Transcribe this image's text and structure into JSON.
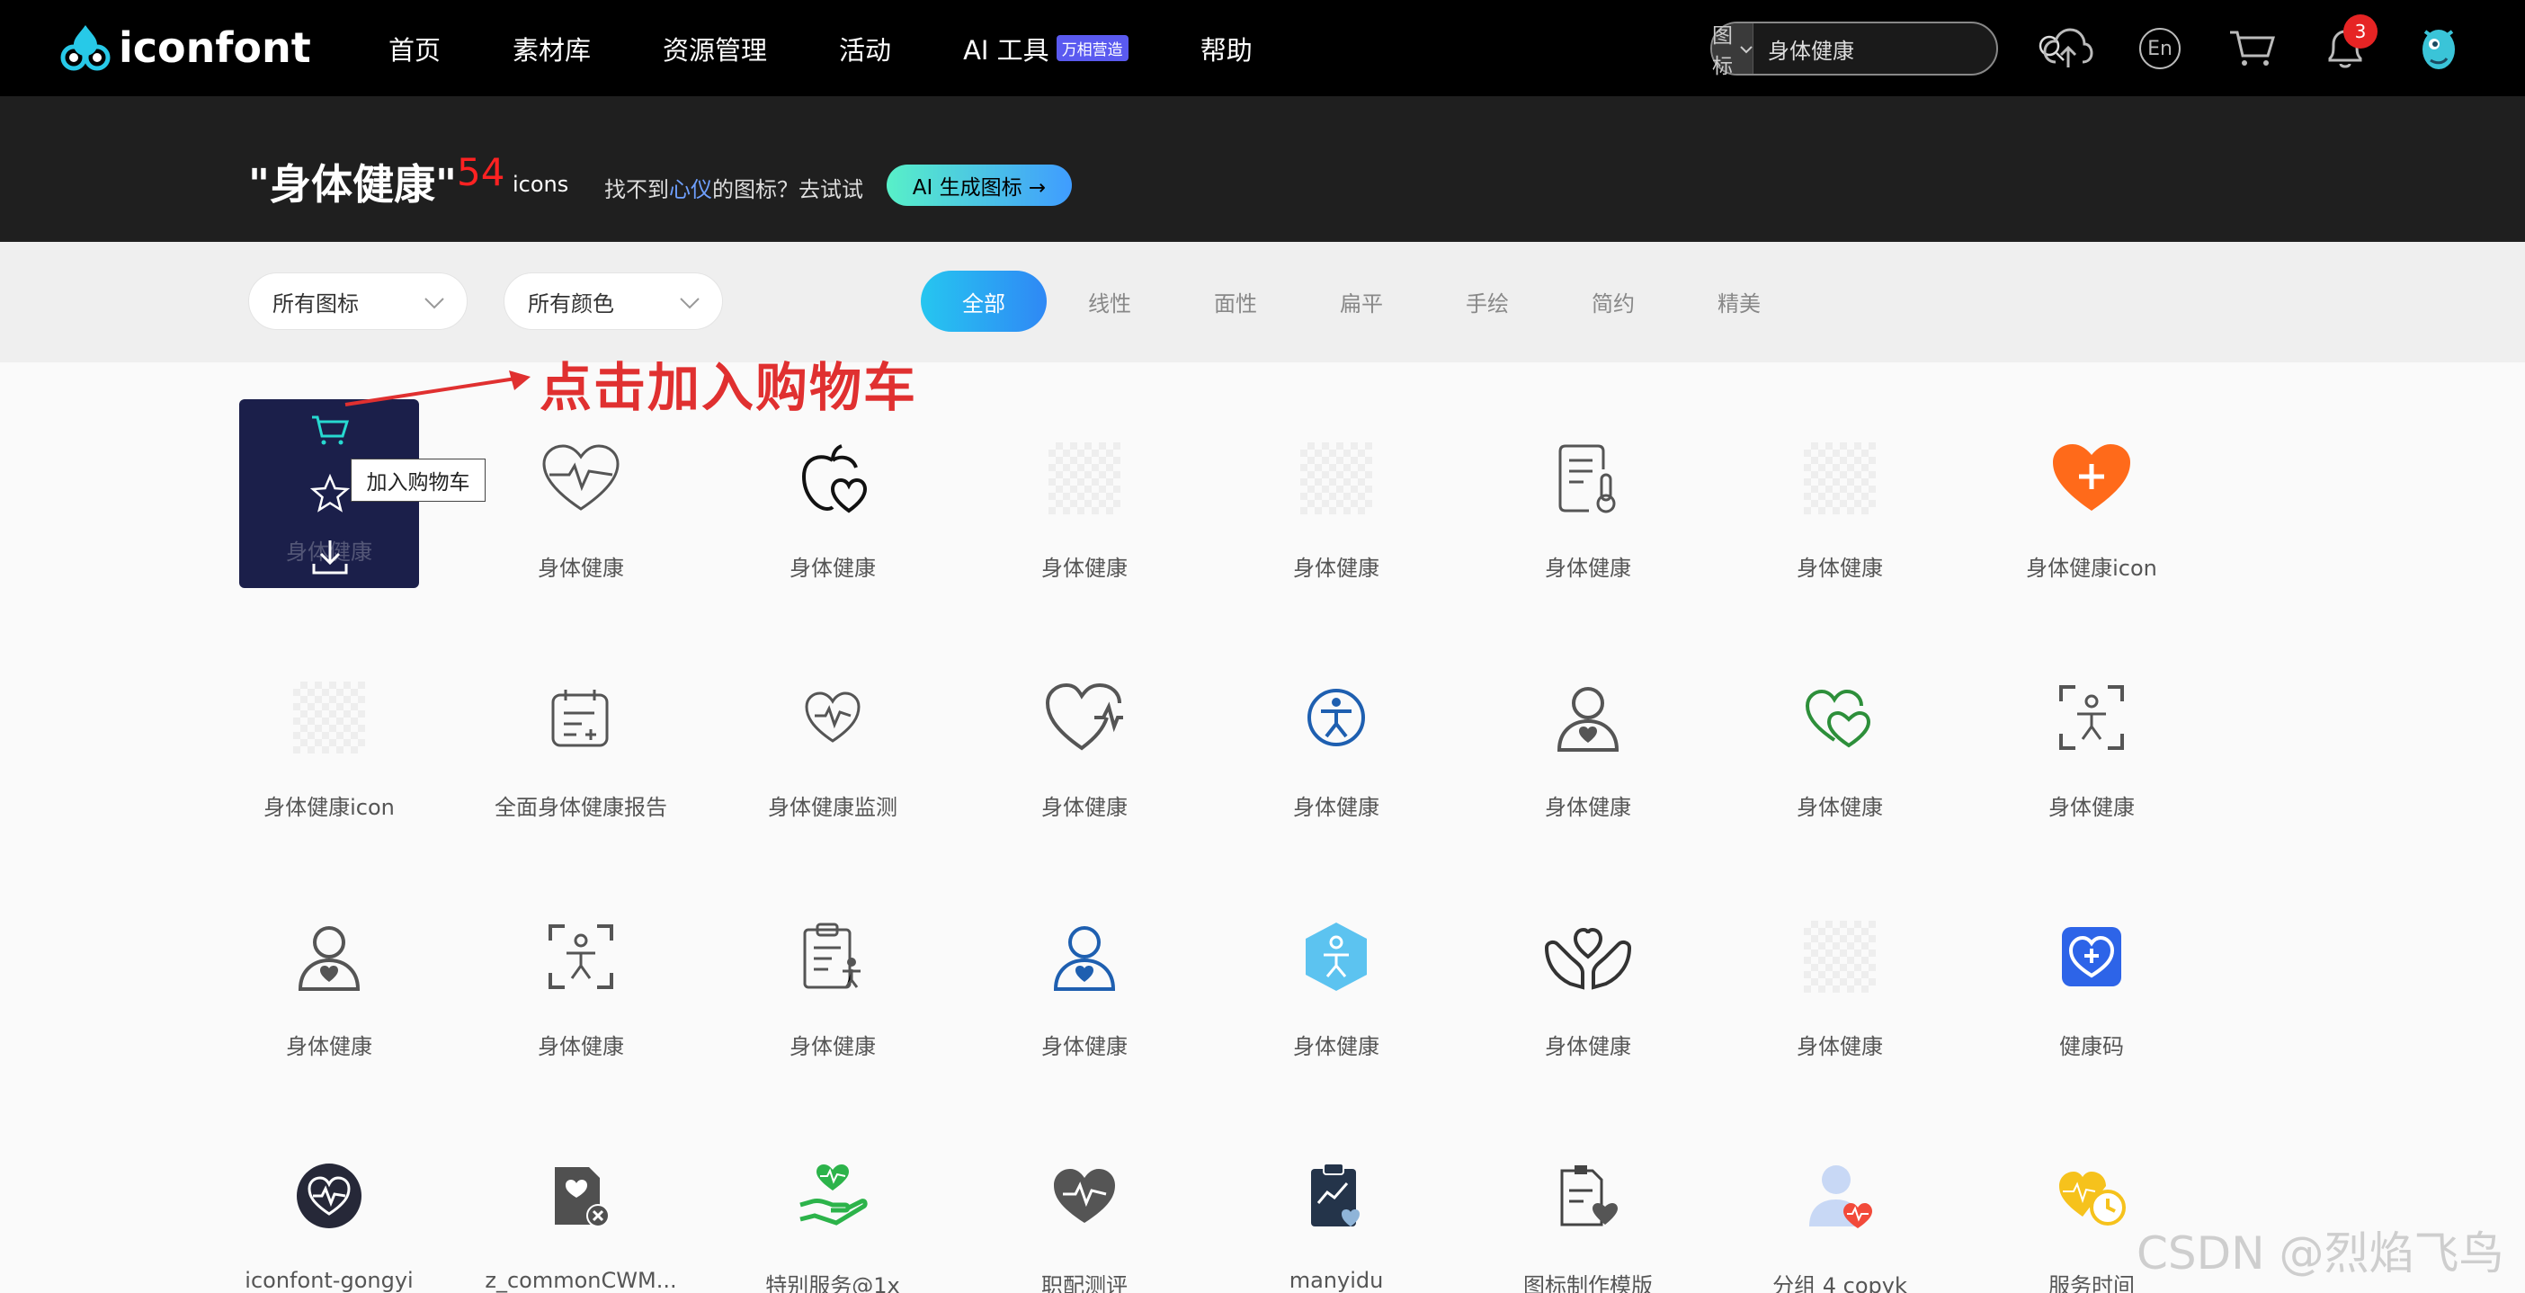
{
  "nav": {
    "logo_text": "iconfont",
    "items": [
      {
        "label": "首页"
      },
      {
        "label": "素材库"
      },
      {
        "label": "资源管理"
      },
      {
        "label": "活动"
      },
      {
        "label": "AI 工具",
        "badge": "万相营造"
      },
      {
        "label": "帮助"
      }
    ],
    "search": {
      "type": "图标",
      "value": "身体健康"
    },
    "lang": "En",
    "notifications": "3"
  },
  "hero": {
    "title": "\"身体健康\"",
    "count": "54",
    "unit": "icons",
    "hint_prefix": "找不到",
    "hint_highlight": "心仪",
    "hint_suffix": "的图标？去试试",
    "ai_button": "AI 生成图标 →"
  },
  "filters": {
    "type_select": "所有图标",
    "color_select": "所有颜色",
    "tabs": [
      "全部",
      "线性",
      "面性",
      "扁平",
      "手绘",
      "简约",
      "精美"
    ],
    "active_tab": "全部"
  },
  "hover_card": {
    "tooltip": "加入购物车",
    "hidden_label": "身体健康"
  },
  "annotation": "点击加入购物车",
  "watermark": "CSDN @烈焰飞鸟",
  "icons": [
    {
      "label": "身体健康",
      "glyph": "heart-monitor"
    },
    {
      "label": "身体健康",
      "glyph": "heart-outline-pulse"
    },
    {
      "label": "身体健康",
      "glyph": "apple-heart"
    },
    {
      "label": "身体健康",
      "glyph": "placeholder"
    },
    {
      "label": "身体健康",
      "glyph": "placeholder"
    },
    {
      "label": "身体健康",
      "glyph": "report-thermometer"
    },
    {
      "label": "身体健康",
      "glyph": "placeholder"
    },
    {
      "label": "身体健康icon",
      "glyph": "heart-plus-orange"
    },
    {
      "label": "身体健康icon",
      "glyph": "placeholder"
    },
    {
      "label": "全面身体健康报告",
      "glyph": "calendar-report"
    },
    {
      "label": "身体健康监测",
      "glyph": "heart-pulse-small"
    },
    {
      "label": "身体健康",
      "glyph": "heart-pulse-large"
    },
    {
      "label": "身体健康",
      "glyph": "accessibility-blue"
    },
    {
      "label": "身体健康",
      "glyph": "person-heart"
    },
    {
      "label": "身体健康",
      "glyph": "hearts-green"
    },
    {
      "label": "身体健康",
      "glyph": "body-scan"
    },
    {
      "label": "身体健康",
      "glyph": "person-heart"
    },
    {
      "label": "身体健康",
      "glyph": "body-scan"
    },
    {
      "label": "身体健康",
      "glyph": "clipboard-person"
    },
    {
      "label": "身体健康",
      "glyph": "person-heart-blue"
    },
    {
      "label": "身体健康",
      "glyph": "hexagon-person"
    },
    {
      "label": "身体健康",
      "glyph": "hands-heart"
    },
    {
      "label": "身体健康",
      "glyph": "placeholder"
    },
    {
      "label": "健康码",
      "glyph": "heart-plus-blue-square"
    },
    {
      "label": "iconfont-gongyi",
      "glyph": "heart-pulse-circle"
    },
    {
      "label": "z_commonCWM...",
      "glyph": "heart-doc-x"
    },
    {
      "label": "特别服务@1x",
      "glyph": "hand-heart-green"
    },
    {
      "label": "职配测评",
      "glyph": "heart-pulse-gray"
    },
    {
      "label": "manyidu",
      "glyph": "clipboard-chart"
    },
    {
      "label": "图标制作模版",
      "glyph": "doc-heart"
    },
    {
      "label": "分组 4 copyk",
      "glyph": "person-heart-red"
    },
    {
      "label": "服务时间",
      "glyph": "hearts-yellow"
    }
  ],
  "colors": {
    "accent_blue": "#2f88f5",
    "accent_cyan": "#26c6f0",
    "count_red": "#ff2222",
    "annotation_red": "#e03030",
    "hover_card": "#1b1f4a"
  }
}
